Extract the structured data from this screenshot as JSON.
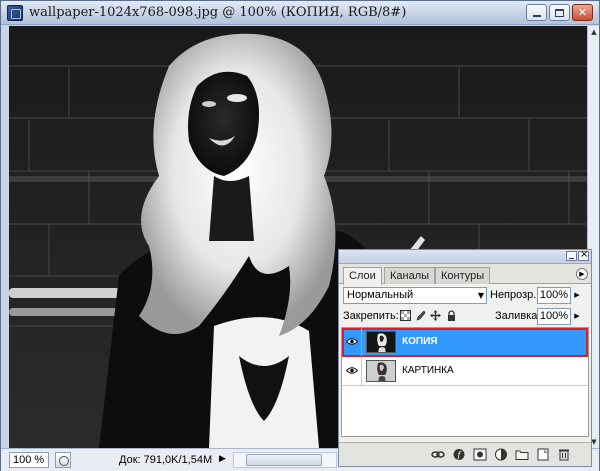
{
  "window": {
    "title": "wallpaper-1024x768-098.jpg @ 100% (КОПИЯ, RGB/8#)"
  },
  "status": {
    "zoom": "100 %",
    "doc_info": "Док: 791,0K/1,54M"
  },
  "layers_panel": {
    "tabs": [
      {
        "label": "Слои",
        "active": true
      },
      {
        "label": "Каналы",
        "active": false
      },
      {
        "label": "Контуры",
        "active": false
      }
    ],
    "blend_mode": "Нормальный",
    "opacity_label": "Непрозр.:",
    "opacity_value": "100%",
    "lock_label": "Закрепить:",
    "fill_label": "Заливка:",
    "fill_value": "100%",
    "layers": [
      {
        "name": "КОПИЯ",
        "visible": true,
        "selected": true
      },
      {
        "name": "КАРТИНКА",
        "visible": true,
        "selected": false
      }
    ],
    "footer_icons": [
      "link-icon",
      "layer-style-icon",
      "mask-icon",
      "adjustment-icon",
      "group-folder-icon",
      "new-layer-icon",
      "trash-icon"
    ]
  },
  "colors": {
    "selected_layer": "#3399ff",
    "highlight_outline": "#d8202c",
    "canvas_bg": "#111111"
  }
}
